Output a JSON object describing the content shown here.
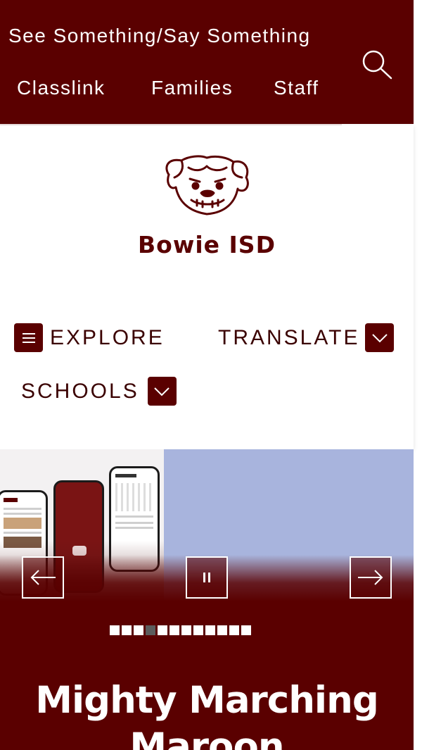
{
  "top_links": [
    "See Something/Say Something",
    "Classlink",
    "Families",
    "Staff"
  ],
  "search": {
    "icon": "search-icon"
  },
  "site": {
    "title": "Bowie ISD",
    "logo": "bulldog-mascot-logo"
  },
  "nav": {
    "explore": {
      "label": "EXPLORE",
      "icon": "menu-icon"
    },
    "translate": {
      "label": "TRANSLATE",
      "icon": "chevron-down-icon"
    },
    "schools": {
      "label": "SCHOOLS",
      "icon": "chevron-down-icon"
    }
  },
  "slider": {
    "prev_icon": "arrow-left-icon",
    "pause_icon": "pause-icon",
    "next_icon": "arrow-right-icon",
    "slide_count": 12,
    "active_index": 3
  },
  "headline": {
    "line1": "Mighty Marching",
    "line2": "Maroon"
  },
  "colors": {
    "brand": "#5a0000",
    "slide_bg": "#a8b4dd",
    "inactive_dot": "#5c5c5c",
    "white": "#ffffff"
  }
}
